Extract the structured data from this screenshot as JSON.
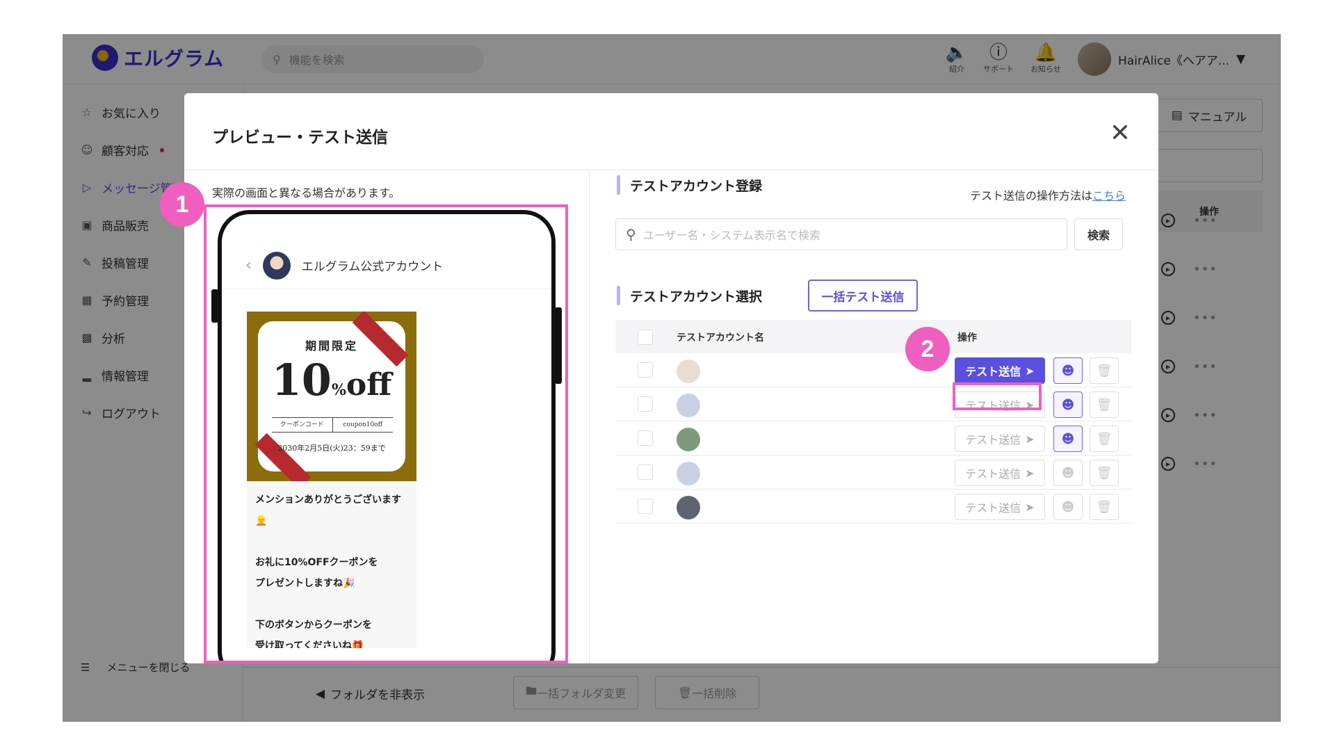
{
  "app": {
    "logo_text": "エルグラム",
    "search_placeholder": "機能を検索",
    "header_icons": [
      {
        "label": "紹介",
        "icon": "megaphone-icon"
      },
      {
        "label": "サポート",
        "icon": "help-icon"
      },
      {
        "label": "お知らせ",
        "icon": "bell-icon"
      }
    ],
    "user_name": "HairAlice《ヘアア...",
    "sidebar": [
      {
        "label": "お気に入り",
        "icon": "star-icon"
      },
      {
        "label": "顧客対応",
        "icon": "person-icon",
        "badge": true
      },
      {
        "label": "メッセージ管理",
        "icon": "send-icon",
        "active": true
      },
      {
        "label": "商品販売",
        "icon": "store-icon"
      },
      {
        "label": "投稿管理",
        "icon": "edit-icon"
      },
      {
        "label": "予約管理",
        "icon": "calendar-icon"
      },
      {
        "label": "分析",
        "icon": "chart-icon"
      },
      {
        "label": "情報管理",
        "icon": "bar-icon"
      },
      {
        "label": "ログアウト",
        "icon": "logout-icon"
      }
    ],
    "close_menu": "メニューを閉じる",
    "manual_button": "マニュアル",
    "bg_table_op_header": "操作",
    "folder_toggle": "フォルダを非表示",
    "footer_buttons": [
      "一括フォルダ変更",
      "一括削除"
    ]
  },
  "modal": {
    "title": "プレビュー・テスト送信",
    "close_glyph": "✕",
    "preview_note": "実際の画面と異なる場合があります。",
    "chat_account_name": "エルグラム公式アカウント",
    "coupon": {
      "headline": "期間限定",
      "big_number": "10",
      "percent": "%",
      "off": "off",
      "code_label": "クーポンコード",
      "code_value": "coupon10off",
      "deadline": "2030年2月5日(火)23：59まで"
    },
    "message_text": "メンションありがとうございます\n👱\n\nお礼に10%OFFクーポンを\nプレゼントしますね🎉\n\n下のボタンからクーポンを\n受け取ってくださいね🎁",
    "register_section_title": "テストアカウント登録",
    "howto_prefix": "テスト送信の操作方法は",
    "howto_link": "こちら",
    "account_search_placeholder": "ユーザー名・システム表示名で検索",
    "search_button": "検索",
    "select_section_title": "テストアカウント選択",
    "bulk_send_button": "一括テスト送信",
    "table": {
      "col_name": "テストアカウント名",
      "col_op": "操作",
      "send_label": "テスト送信",
      "rows": [
        {
          "avatar_color": "#e9dcd2",
          "send_active": true,
          "user_active": true
        },
        {
          "avatar_color": "#c9d0e4",
          "send_active": false,
          "user_active": true
        },
        {
          "avatar_color": "#7f9a7a",
          "send_active": false,
          "user_active": true
        },
        {
          "avatar_color": "#c9d0e4",
          "send_active": false,
          "user_active": false
        },
        {
          "avatar_color": "#5d6470",
          "send_active": false,
          "user_active": false
        }
      ]
    }
  },
  "callouts": [
    "1",
    "2"
  ],
  "colors": {
    "accent": "#5b4fe0",
    "highlight": "#f05fbf",
    "coupon_frame": "#8b6d0c",
    "coupon_ribbon": "#b7292f"
  }
}
